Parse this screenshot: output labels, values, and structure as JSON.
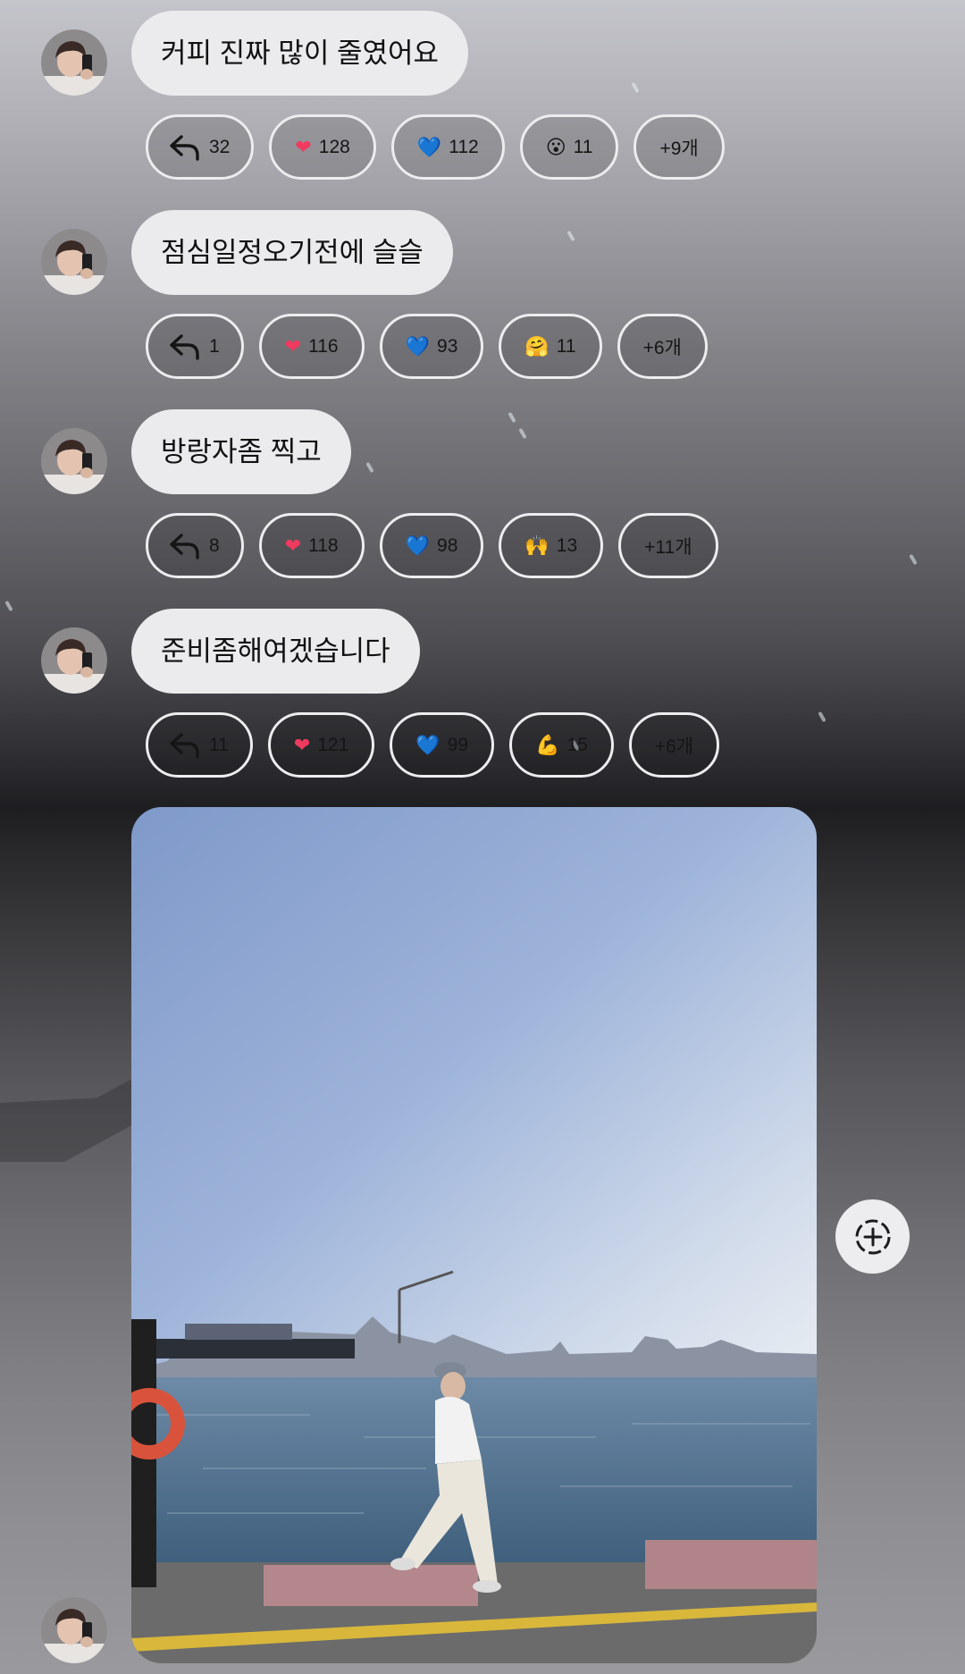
{
  "messages": [
    {
      "text": "커피 진짜 많이 줄였어요",
      "reactions": {
        "reply_count": "32",
        "heart_red": "128",
        "heart_blue": "112",
        "emoji3_icon": "😮",
        "emoji3_count": "11",
        "more": "+9개"
      }
    },
    {
      "text": "점심일정오기전에 슬슬",
      "reactions": {
        "reply_count": "1",
        "heart_red": "116",
        "heart_blue": "93",
        "emoji3_icon": "🤗",
        "emoji3_count": "11",
        "more": "+6개"
      }
    },
    {
      "text": "방랑자좀 찍고",
      "reactions": {
        "reply_count": "8",
        "heart_red": "118",
        "heart_blue": "98",
        "emoji3_icon": "🙌",
        "emoji3_count": "13",
        "more": "+11개"
      }
    },
    {
      "text": "준비좀해여겠습니다",
      "reactions": {
        "reply_count": "11",
        "heart_red": "121",
        "heart_blue": "99",
        "emoji3_icon": "💪",
        "emoji3_count": "15",
        "more": "+6개"
      }
    }
  ],
  "icons": {
    "red_heart": "❤",
    "blue_heart": "💙"
  },
  "colors": {
    "bubble_bg": "#ebebed",
    "pill_border": "#ededef",
    "heart_red": "#f03a5f",
    "heart_blue": "#2f8df0"
  }
}
